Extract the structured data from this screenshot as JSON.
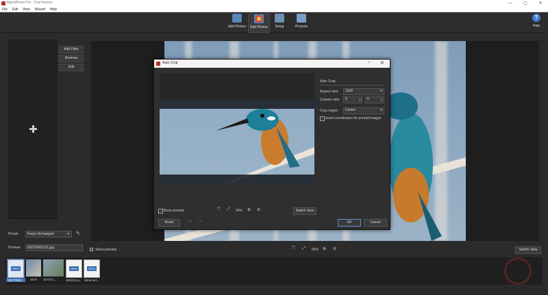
{
  "window": {
    "title": "BatchPhoto Pro - Trial Version"
  },
  "menu": [
    "File",
    "Edit",
    "View",
    "Wizard",
    "Help"
  ],
  "toolbar": {
    "buttons": [
      {
        "label": "Add Photos",
        "icon": "add-photos-icon"
      },
      {
        "label": "Edit Photos",
        "icon": "edit-photos-icon"
      },
      {
        "label": "Setup",
        "icon": "setup-icon"
      },
      {
        "label": "Process",
        "icon": "process-icon"
      }
    ],
    "help_label": "Help"
  },
  "left": {
    "add_filter": "Add Filter",
    "remove": "Remove",
    "edit": "Edit",
    "preset_label": "Preset",
    "preset_value": "Keep Unchanged",
    "preview_label": "Preview",
    "preview_value": "00270000101.jpg"
  },
  "bottom": {
    "show_preview": "Show preview",
    "zoom": "65%",
    "switch_view": "Switch View"
  },
  "thumbnails": [
    {
      "caption": "00270000...",
      "type": "JPEG",
      "selected": true
    },
    {
      "caption": "3676",
      "type": "photo"
    },
    {
      "caption": "527317_...",
      "type": "photo"
    },
    {
      "caption": "800233-g...",
      "type": "JPEG"
    },
    {
      "caption": "bimeroid...",
      "type": "JPEG"
    }
  ],
  "dialog": {
    "title": "Auto Crop",
    "section_title": "Auto Crop",
    "aspect_label": "Aspect ratio",
    "aspect_value": "16x9",
    "custom_label": "Custom ratio",
    "custom_w": "0",
    "custom_sep": ":",
    "custom_h": "0",
    "region_label": "Crop region",
    "region_value": "Center",
    "invert_label": "Invert coordinates for portrait images",
    "invert_checked": true,
    "show_preview": "Show preview",
    "show_preview_checked": true,
    "zoom": "34%",
    "switch_view": "Switch View",
    "reset": "Reset",
    "ok": "OK",
    "cancel": "Cancel"
  },
  "colors": {
    "accent": "#3d6fb6",
    "brand": "#b5332b",
    "bg": "#2b2b2b"
  }
}
